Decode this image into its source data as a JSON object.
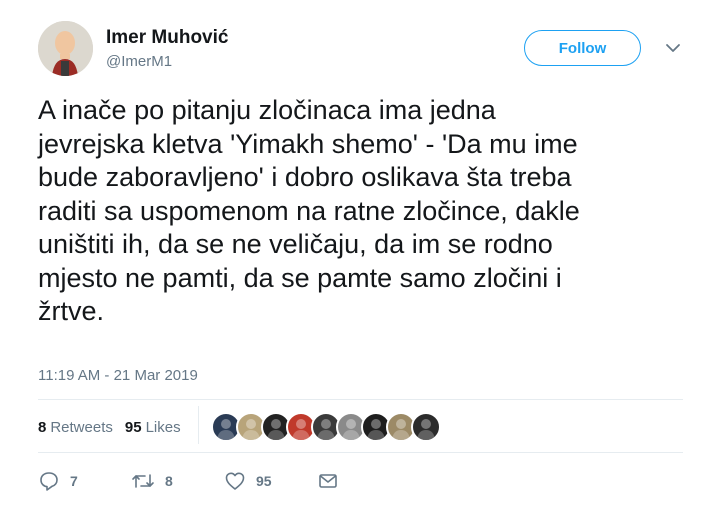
{
  "user": {
    "display_name": "Imer Muhović",
    "handle": "@ImerM1"
  },
  "follow": {
    "label": "Follow"
  },
  "tweet": {
    "text": "A inače po pitanju zločinaca ima jedna\njevrejska kletva 'Yimakh shemo' - 'Da mu ime\nbude zaboravljeno' i dobro oslikava šta treba\nraditi sa uspomenom na ratne zločince, dakle\nuništiti ih, da se ne veličaju, da im se rodno\nmjesto ne pamti, da se pamte samo zločini i\nžrtve.",
    "timestamp": "11:19 AM - 21 Mar 2019"
  },
  "stats": {
    "retweets_count": "8",
    "retweets_label": "Retweets",
    "likes_count": "95",
    "likes_label": "Likes"
  },
  "likers": [
    {
      "name": "liker-avatar-1",
      "color": "#2a3b55"
    },
    {
      "name": "liker-avatar-2",
      "color": "#b8a47a"
    },
    {
      "name": "liker-avatar-3",
      "color": "#222222"
    },
    {
      "name": "liker-avatar-4",
      "color": "#c0392b"
    },
    {
      "name": "liker-avatar-5",
      "color": "#3a3a3a"
    },
    {
      "name": "liker-avatar-6",
      "color": "#8a8a8a"
    },
    {
      "name": "liker-avatar-7",
      "color": "#1e1e1e"
    },
    {
      "name": "liker-avatar-8",
      "color": "#9c8a66"
    },
    {
      "name": "liker-avatar-9",
      "color": "#2b2b2b"
    }
  ],
  "actions": {
    "replies": "7",
    "retweets": "8",
    "likes": "95"
  },
  "colors": {
    "accent": "#1da1f2",
    "muted": "#657786",
    "text": "#14171a"
  }
}
